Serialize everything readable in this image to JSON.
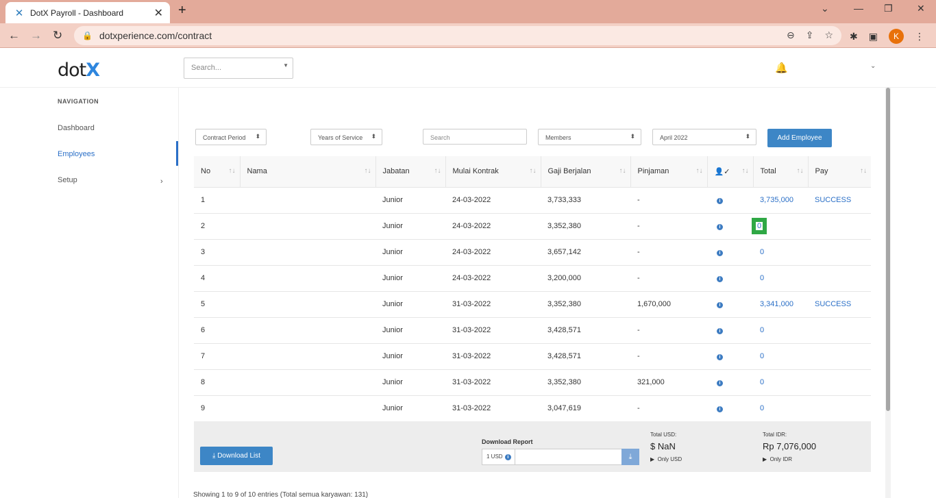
{
  "browser": {
    "tab_title": "DotX Payroll - Dashboard",
    "url": "dotxperience.com/contract",
    "profile_initial": "K"
  },
  "app": {
    "logo_text": "dot",
    "logo_mark": "X",
    "search_placeholder": "Search..."
  },
  "sidebar": {
    "heading": "NAVIGATION",
    "items": [
      {
        "label": "Dashboard"
      },
      {
        "label": "Employees"
      },
      {
        "label": "Setup"
      }
    ]
  },
  "filters": {
    "contract_period": "Contract Period",
    "years_of_service": "Years of Service",
    "search_placeholder": "Search",
    "members": "Members",
    "month": "April 2022",
    "add_employee": "Add Employee"
  },
  "table": {
    "headers": [
      "No",
      "Nama",
      "Jabatan",
      "Mulai Kontrak",
      "Gaji Berjalan",
      "Pinjaman",
      "",
      "Total",
      "Pay"
    ],
    "rows": [
      {
        "no": "1",
        "nama": "",
        "jabatan": "Junior",
        "mulai": "24-03-2022",
        "gaji": "3,733,333",
        "pinjaman": "-",
        "total": "3,735,000",
        "pay": "SUCCESS"
      },
      {
        "no": "2",
        "nama": "",
        "jabatan": "Junior",
        "mulai": "24-03-2022",
        "gaji": "3,352,380",
        "pinjaman": "-",
        "total": "0",
        "pay": ""
      },
      {
        "no": "3",
        "nama": "",
        "jabatan": "Junior",
        "mulai": "24-03-2022",
        "gaji": "3,657,142",
        "pinjaman": "-",
        "total": "0",
        "pay": ""
      },
      {
        "no": "4",
        "nama": "",
        "jabatan": "Junior",
        "mulai": "24-03-2022",
        "gaji": "3,200,000",
        "pinjaman": "-",
        "total": "0",
        "pay": ""
      },
      {
        "no": "5",
        "nama": "",
        "jabatan": "Junior",
        "mulai": "31-03-2022",
        "gaji": "3,352,380",
        "pinjaman": "1,670,000",
        "total": "3,341,000",
        "pay": "SUCCESS"
      },
      {
        "no": "6",
        "nama": "",
        "jabatan": "Junior",
        "mulai": "31-03-2022",
        "gaji": "3,428,571",
        "pinjaman": "-",
        "total": "0",
        "pay": ""
      },
      {
        "no": "7",
        "nama": "",
        "jabatan": "Junior",
        "mulai": "31-03-2022",
        "gaji": "3,428,571",
        "pinjaman": "-",
        "total": "0",
        "pay": ""
      },
      {
        "no": "8",
        "nama": "",
        "jabatan": "Junior",
        "mulai": "31-03-2022",
        "gaji": "3,352,380",
        "pinjaman": "321,000",
        "total": "0",
        "pay": ""
      },
      {
        "no": "9",
        "nama": "",
        "jabatan": "Junior",
        "mulai": "31-03-2022",
        "gaji": "3,047,619",
        "pinjaman": "-",
        "total": "0",
        "pay": ""
      }
    ]
  },
  "footer": {
    "download_list": "Download List",
    "download_report_label": "Download Report",
    "usd_rate": "1 USD",
    "total_usd_label": "Total USD:",
    "total_usd_value": "$ NaN",
    "only_usd": "Only USD",
    "total_idr_label": "Total IDR:",
    "total_idr_value": "Rp 7,076,000",
    "only_idr": "Only IDR"
  },
  "showing_text": "Showing 1 to 9 of 10 entries (Total semua karyawan: 131)",
  "colors": {
    "accent": "#2a6fc7",
    "button": "#3d86c6",
    "highlight": "#2fa845",
    "tabbar": "#e3aa9a"
  }
}
